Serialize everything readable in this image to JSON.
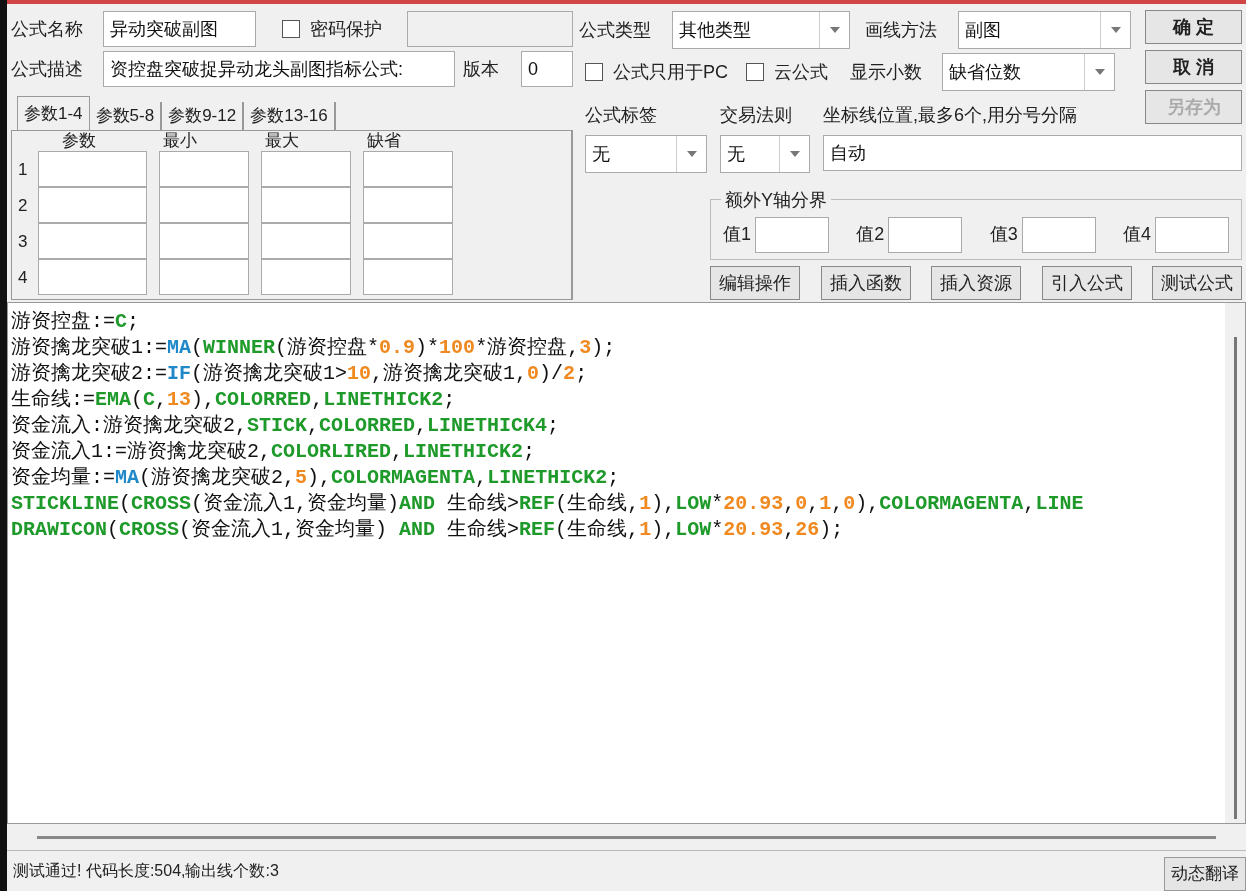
{
  "formula_name": {
    "label": "公式名称",
    "value": "异动突破副图"
  },
  "password": {
    "label": "密码保护",
    "checked": false
  },
  "description": {
    "label": "公式描述",
    "value": "资控盘突破捉异动龙头副图指标公式:"
  },
  "version": {
    "label": "版本",
    "value": "0"
  },
  "param_tabs": [
    {
      "label": "参数1-4",
      "selected": true
    },
    {
      "label": "参数5-8",
      "selected": false
    },
    {
      "label": "参数9-12",
      "selected": false
    },
    {
      "label": "参数13-16",
      "selected": false
    }
  ],
  "param_columns": [
    "参数",
    "最小",
    "最大",
    "缺省"
  ],
  "param_rows": [
    "1",
    "2",
    "3",
    "4"
  ],
  "formula_type": {
    "label": "公式类型",
    "value": "其他类型"
  },
  "draw_method": {
    "label": "画线方法",
    "value": "副图"
  },
  "options": [
    {
      "label": "公式只用于PC",
      "checked": false
    },
    {
      "label": "云公式",
      "checked": false
    }
  ],
  "decimals": {
    "label": "显示小数",
    "value": "缺省位数"
  },
  "dialog_buttons": [
    {
      "label": "确 定",
      "disabled": false
    },
    {
      "label": "取 消",
      "disabled": false
    },
    {
      "label": "另存为",
      "disabled": true
    }
  ],
  "formula_tag": {
    "label": "公式标签",
    "value": "无"
  },
  "trade_rule": {
    "label": "交易法则",
    "value": "无"
  },
  "axis_lines": {
    "label": "坐标线位置,最多6个,用分号分隔",
    "value": "自动"
  },
  "y_bounds": {
    "title": "额外Y轴分界",
    "fields": [
      "值1",
      "值2",
      "值3",
      "值4"
    ]
  },
  "tool_buttons": [
    "编辑操作",
    "插入函数",
    "插入资源",
    "引入公式",
    "测试公式"
  ],
  "code_lines": [
    [
      {
        "kind": "plain",
        "text": "游资控盘:="
      },
      {
        "kind": "keyword",
        "text": "C"
      },
      {
        "kind": "plain",
        "text": ";"
      }
    ],
    [
      {
        "kind": "plain",
        "text": "游资擒龙突破1:="
      },
      {
        "kind": "function",
        "text": "MA"
      },
      {
        "kind": "plain",
        "text": "("
      },
      {
        "kind": "keyword",
        "text": "WINNER"
      },
      {
        "kind": "plain",
        "text": "(游资控盘*"
      },
      {
        "kind": "number",
        "text": "0.9"
      },
      {
        "kind": "plain",
        "text": ")*"
      },
      {
        "kind": "number",
        "text": "100"
      },
      {
        "kind": "plain",
        "text": "*游资控盘,"
      },
      {
        "kind": "number",
        "text": "3"
      },
      {
        "kind": "plain",
        "text": ");"
      }
    ],
    [
      {
        "kind": "plain",
        "text": "游资擒龙突破2:="
      },
      {
        "kind": "function",
        "text": "IF"
      },
      {
        "kind": "plain",
        "text": "(游资擒龙突破1>"
      },
      {
        "kind": "number",
        "text": "10"
      },
      {
        "kind": "plain",
        "text": ",游资擒龙突破1,"
      },
      {
        "kind": "number",
        "text": "0"
      },
      {
        "kind": "plain",
        "text": ")/"
      },
      {
        "kind": "number",
        "text": "2"
      },
      {
        "kind": "plain",
        "text": ";"
      }
    ],
    [
      {
        "kind": "plain",
        "text": "生命线:="
      },
      {
        "kind": "keyword",
        "text": "EMA"
      },
      {
        "kind": "plain",
        "text": "("
      },
      {
        "kind": "keyword",
        "text": "C"
      },
      {
        "kind": "plain",
        "text": ","
      },
      {
        "kind": "number",
        "text": "13"
      },
      {
        "kind": "plain",
        "text": "),"
      },
      {
        "kind": "keyword",
        "text": "COLORRED"
      },
      {
        "kind": "plain",
        "text": ","
      },
      {
        "kind": "keyword",
        "text": "LINETHICK2"
      },
      {
        "kind": "plain",
        "text": ";"
      }
    ],
    [
      {
        "kind": "plain",
        "text": "资金流入:游资擒龙突破2,"
      },
      {
        "kind": "keyword",
        "text": "STICK"
      },
      {
        "kind": "plain",
        "text": ","
      },
      {
        "kind": "keyword",
        "text": "COLORRED"
      },
      {
        "kind": "plain",
        "text": ","
      },
      {
        "kind": "keyword",
        "text": "LINETHICK4"
      },
      {
        "kind": "plain",
        "text": ";"
      }
    ],
    [
      {
        "kind": "plain",
        "text": "资金流入1:=游资擒龙突破2,"
      },
      {
        "kind": "keyword",
        "text": "COLORLIRED"
      },
      {
        "kind": "plain",
        "text": ","
      },
      {
        "kind": "keyword",
        "text": "LINETHICK2"
      },
      {
        "kind": "plain",
        "text": ";"
      }
    ],
    [
      {
        "kind": "plain",
        "text": "资金均量:="
      },
      {
        "kind": "function",
        "text": "MA"
      },
      {
        "kind": "plain",
        "text": "(游资擒龙突破2,"
      },
      {
        "kind": "number",
        "text": "5"
      },
      {
        "kind": "plain",
        "text": "),"
      },
      {
        "kind": "keyword",
        "text": "COLORMAGENTA"
      },
      {
        "kind": "plain",
        "text": ","
      },
      {
        "kind": "keyword",
        "text": "LINETHICK2"
      },
      {
        "kind": "plain",
        "text": ";"
      }
    ],
    [
      {
        "kind": "keyword",
        "text": "STICKLINE"
      },
      {
        "kind": "plain",
        "text": "("
      },
      {
        "kind": "keyword",
        "text": "CROSS"
      },
      {
        "kind": "plain",
        "text": "(资金流入1,资金均量)"
      },
      {
        "kind": "keyword",
        "text": "AND"
      },
      {
        "kind": "plain",
        "text": " 生命线>"
      },
      {
        "kind": "keyword",
        "text": "REF"
      },
      {
        "kind": "plain",
        "text": "(生命线,"
      },
      {
        "kind": "number",
        "text": "1"
      },
      {
        "kind": "plain",
        "text": "),"
      },
      {
        "kind": "keyword",
        "text": "LOW"
      },
      {
        "kind": "plain",
        "text": "*"
      },
      {
        "kind": "number",
        "text": "20.93"
      },
      {
        "kind": "plain",
        "text": ","
      },
      {
        "kind": "number",
        "text": "0"
      },
      {
        "kind": "plain",
        "text": ","
      },
      {
        "kind": "number",
        "text": "1"
      },
      {
        "kind": "plain",
        "text": ","
      },
      {
        "kind": "number",
        "text": "0"
      },
      {
        "kind": "plain",
        "text": "),"
      },
      {
        "kind": "keyword",
        "text": "COLORMAGENTA"
      },
      {
        "kind": "plain",
        "text": ","
      },
      {
        "kind": "keyword",
        "text": "LINE"
      }
    ],
    [
      {
        "kind": "keyword",
        "text": "DRAWICON"
      },
      {
        "kind": "plain",
        "text": "("
      },
      {
        "kind": "keyword",
        "text": "CROSS"
      },
      {
        "kind": "plain",
        "text": "(资金流入1,资金均量) "
      },
      {
        "kind": "keyword",
        "text": "AND"
      },
      {
        "kind": "plain",
        "text": " 生命线>"
      },
      {
        "kind": "keyword",
        "text": "REF"
      },
      {
        "kind": "plain",
        "text": "(生命线,"
      },
      {
        "kind": "number",
        "text": "1"
      },
      {
        "kind": "plain",
        "text": "),"
      },
      {
        "kind": "keyword",
        "text": "LOW"
      },
      {
        "kind": "plain",
        "text": "*"
      },
      {
        "kind": "number",
        "text": "20.93"
      },
      {
        "kind": "plain",
        "text": ","
      },
      {
        "kind": "number",
        "text": "26"
      },
      {
        "kind": "plain",
        "text": ");"
      }
    ]
  ],
  "status_text": "测试通过! 代码长度:504,输出线个数:3",
  "translate_button": "动态翻译"
}
